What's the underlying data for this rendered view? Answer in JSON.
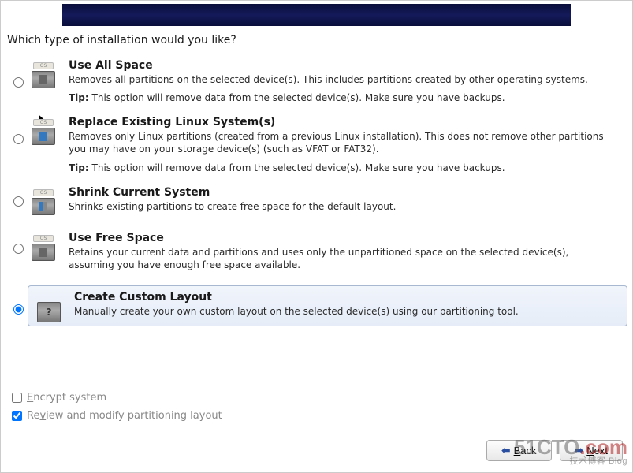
{
  "prompt": "Which type of installation would you like?",
  "options": [
    {
      "title": "Use All Space",
      "desc": "Removes all partitions on the selected device(s).  This includes partitions created by other operating systems.",
      "tip_label": "Tip:",
      "tip": "This option will remove data from the selected device(s).  Make sure you have backups.",
      "selected": false,
      "icon": "disk-all"
    },
    {
      "title": "Replace Existing Linux System(s)",
      "desc": "Removes only Linux partitions (created from a previous Linux installation).  This does not remove other partitions you may have on your storage device(s) (such as VFAT or FAT32).",
      "tip_label": "Tip:",
      "tip": "This option will remove data from the selected device(s).  Make sure you have backups.",
      "selected": false,
      "icon": "disk-replace"
    },
    {
      "title": "Shrink Current System",
      "desc": "Shrinks existing partitions to create free space for the default layout.",
      "tip_label": "",
      "tip": "",
      "selected": false,
      "icon": "disk-shrink"
    },
    {
      "title": "Use Free Space",
      "desc": "Retains your current data and partitions and uses only the unpartitioned space on the selected device(s), assuming you have enough free space available.",
      "tip_label": "",
      "tip": "",
      "selected": false,
      "icon": "disk-free"
    },
    {
      "title": "Create Custom Layout",
      "desc": "Manually create your own custom layout on the selected device(s) using our partitioning tool.",
      "tip_label": "",
      "tip": "",
      "selected": true,
      "icon": "unknown"
    }
  ],
  "checkboxes": {
    "encrypt": {
      "label_pre": "E",
      "label_rest": "ncrypt system",
      "checked": false
    },
    "review": {
      "label_pre": "Re",
      "label_u": "v",
      "label_rest": "iew and modify partitioning layout",
      "checked": true
    }
  },
  "nav": {
    "back": "Back",
    "next": "Next"
  },
  "watermark": {
    "line1a": "51CTO",
    "line1b": ".com",
    "line2": "技术博客  Blog"
  }
}
